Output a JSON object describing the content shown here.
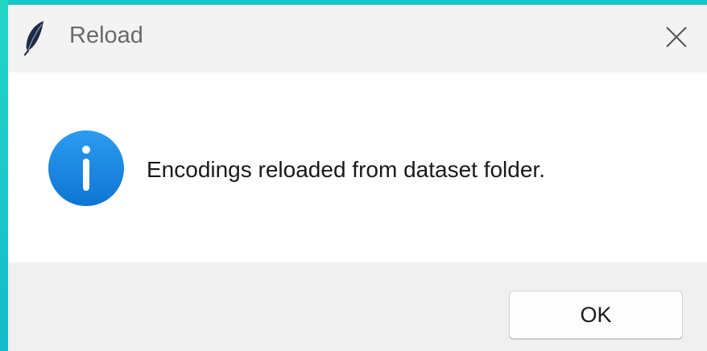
{
  "window": {
    "title": "Reload",
    "app_icon": "feather-icon",
    "close_icon": "close-icon"
  },
  "message": {
    "icon": "info-icon",
    "text": "Encodings reloaded from dataset folder."
  },
  "buttons": {
    "ok_label": "OK"
  },
  "colors": {
    "info_blue": "#1a8ae3",
    "titlebar_bg": "#f3f3f3",
    "footer_bg": "#f0f0f0",
    "background_teal": "#15bfc8"
  }
}
